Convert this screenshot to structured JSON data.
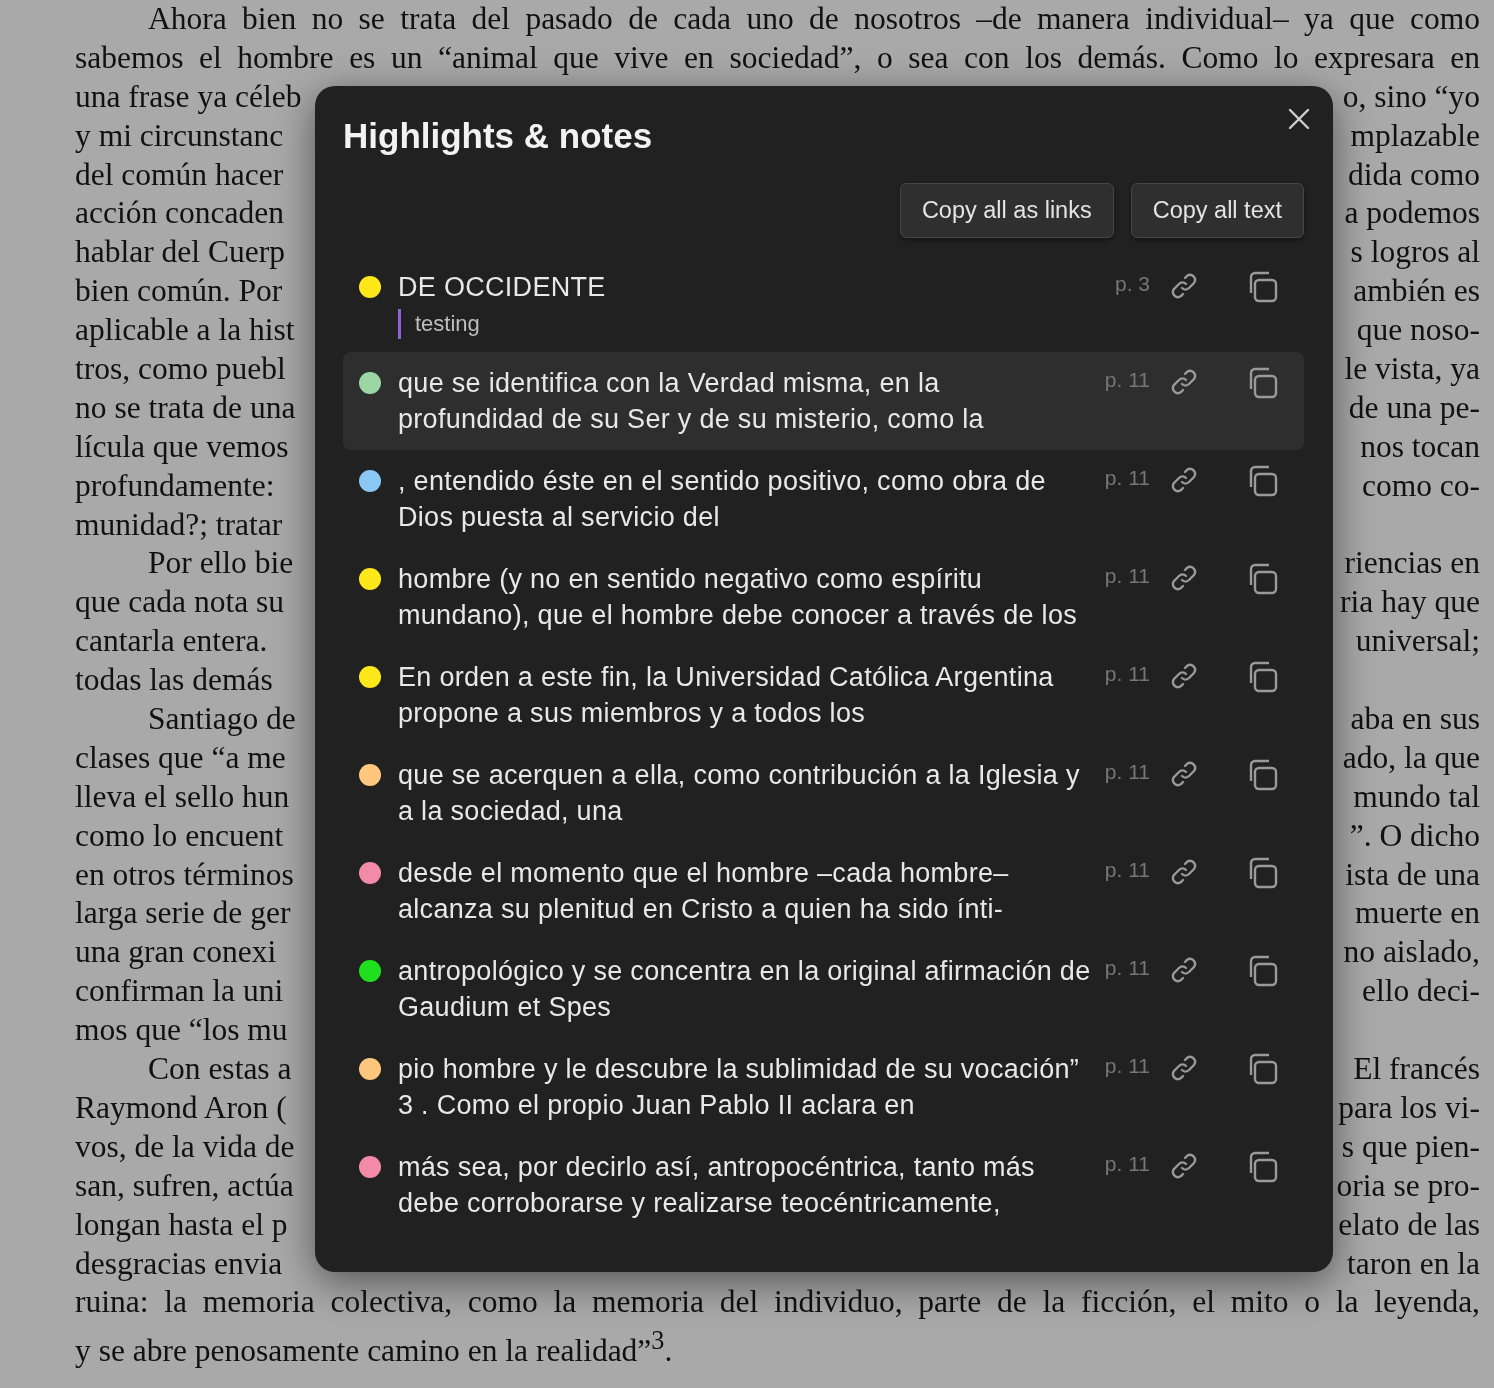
{
  "document": {
    "lines": [
      {
        "text": "Ahora bien no se trata del pasado de cada uno de nosotros –de manera individual– ya que como",
        "indent": true
      },
      {
        "text": "sabemos el hombre es un “animal que vive en sociedad”, o sea con los demás. Como lo expresara en"
      },
      {
        "left": "una frase ya céleb",
        "right": "o, sino “yo"
      },
      {
        "left": "y mi circunstanc",
        "right": "mplazable"
      },
      {
        "left": "del común hacer",
        "right": "dida como"
      },
      {
        "left": "acción concaden",
        "right": "a podemos"
      },
      {
        "left": "hablar del Cuerp",
        "right": "s logros al"
      },
      {
        "left": "bien común. Por",
        "right": "ambién es"
      },
      {
        "left": "aplicable a la hist",
        "right": "que noso-"
      },
      {
        "left": "tros, como puebl",
        "right": "le vista, ya"
      },
      {
        "left": "no se trata de una",
        "right": "de una pe-"
      },
      {
        "left": "lícula que vemos",
        "right": "nos tocan"
      },
      {
        "left": "profundamente:",
        "right": "como co-"
      },
      {
        "left": "munidad?; tratar"
      },
      {
        "left": "Por ello bie",
        "right": "riencias en",
        "indent": true
      },
      {
        "left": "que cada nota su",
        "right": "ria hay que"
      },
      {
        "left": "cantarla entera.",
        "right": "universal;"
      },
      {
        "left": "todas las demás"
      },
      {
        "left": "Santiago de",
        "right": "aba en sus",
        "indent": true
      },
      {
        "left": "clases que “a me",
        "right": "ado, la que"
      },
      {
        "left": "lleva el sello hun",
        "right": "mundo tal"
      },
      {
        "left": "como lo encuent",
        "right": "”. O dicho"
      },
      {
        "left": "en otros términos",
        "right": "ista de una"
      },
      {
        "left": "larga serie de ger",
        "right": "muerte en"
      },
      {
        "left": "una gran conexi",
        "right": "no aislado,"
      },
      {
        "left": "confirman la uni",
        "right": "ello deci-"
      },
      {
        "left": "mos que “los mu"
      },
      {
        "left": "Con estas a",
        "right": "El francés",
        "indent": true
      },
      {
        "left": "Raymond Aron (",
        "right": "para los vi-"
      },
      {
        "left": "vos, de la vida de",
        "right": "s que pien-"
      },
      {
        "left": "san, sufren, actúa",
        "right": "oria se pro-"
      },
      {
        "left": "longan hasta el p",
        "right": "elato de las"
      },
      {
        "left": "desgracias envia",
        "right": "taron en la"
      },
      {
        "text": "ruina: la memoria colectiva, como la memoria del individuo, parte de la ficción, el mito o la leyenda,"
      },
      {
        "text": "y se abre penosamente camino en la realidad”$^{3}$."
      }
    ]
  },
  "dialog": {
    "title": "Highlights & notes",
    "buttons": [
      "Copy all as links",
      "Copy all text"
    ],
    "highlights": [
      {
        "text": "DE OCCIDENTE",
        "note": "testing",
        "page": "p. 3",
        "color": "#ffe81a",
        "selected": false
      },
      {
        "text": "que se identifica con la Verdad misma, en la profundidad de su Ser y de su misterio, como la",
        "page": "p. 11",
        "color": "#9cd6a4",
        "selected": true
      },
      {
        "text": ", entendido éste en el sentido positivo, como obra de Dios puesta al servicio del",
        "page": "p. 11",
        "color": "#8cc8f6",
        "selected": false
      },
      {
        "text": "hombre (y no en sentido negativo como espíritu mundano), que el hombre debe conocer a través de los",
        "page": "p. 11",
        "color": "#ffe81a",
        "selected": false
      },
      {
        "text": "En orden a este fin, la Universidad Católica Argentina propone a sus miembros y a todos los",
        "page": "p. 11",
        "color": "#ffe81a",
        "selected": false
      },
      {
        "text": "que se acerquen a ella, como contribución a la Iglesia y a la sociedad, una",
        "page": "p. 11",
        "color": "#ffc77e",
        "selected": false
      },
      {
        "text": "desde el momento que el hombre –cada hombre– alcanza su plenitud en Cristo a quien ha sido ínti-",
        "page": "p. 11",
        "color": "#f28aa8",
        "selected": false
      },
      {
        "text": "antropológico y se concentra en la original afirmación de Gaudium et Spes",
        "page": "p. 11",
        "color": "#1ee01e",
        "selected": false
      },
      {
        "text": "pio hombre y le descubre la sublimidad de su vocación” 3 . Como el propio Juan Pablo II aclara en",
        "page": "p. 11",
        "color": "#ffc77e",
        "selected": false
      },
      {
        "text": "más sea, por decirlo así, antropocéntrica, tanto más debe corroborarse y realizarse teocéntricamente,",
        "page": "p. 11",
        "color": "#f28aa8",
        "selected": false
      }
    ]
  }
}
